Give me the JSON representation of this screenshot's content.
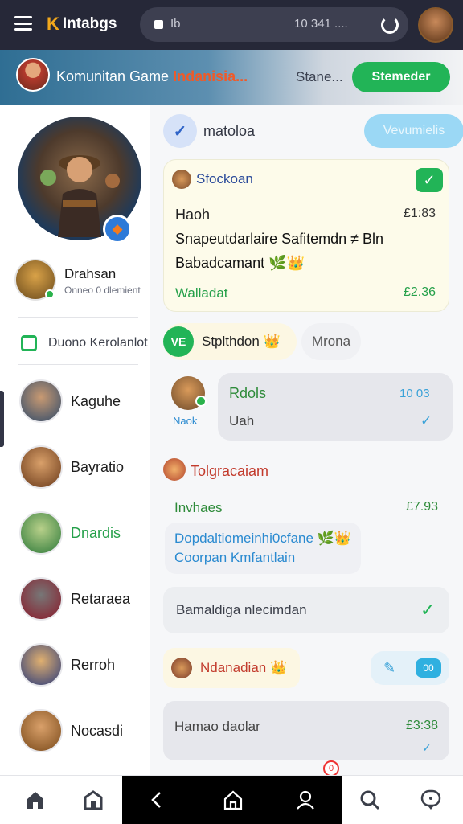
{
  "browser": {
    "app_name": "Intabgs",
    "url_text": "Ib",
    "url_right": "10 341 ....",
    "icons": {
      "menu": "hamburger-icon",
      "logo": "k-logo-icon",
      "reload": "reload-icon"
    }
  },
  "banner": {
    "title": "Komunitan Game ",
    "title_highlight": "Indanisia...",
    "status": "Stane...",
    "button": "Stemeder"
  },
  "sidebar": {
    "profile": {
      "name": "Drahsan",
      "subtitle": "Onneo 0 dlemient"
    },
    "section": "Duono Kerolanlot",
    "users": [
      {
        "name": "Kaguhe",
        "color": "#1e1e1e"
      },
      {
        "name": "Bayratio",
        "color": "#1e1e1e"
      },
      {
        "name": "Dnardis",
        "color": "#25a04a"
      },
      {
        "name": "Retaraea",
        "color": "#1e1e1e"
      },
      {
        "name": "Rerroh",
        "color": "#1e1e1e"
      },
      {
        "name": "Nocasdi",
        "color": "#1e1e1e"
      }
    ]
  },
  "channel": {
    "name": "matoloa",
    "button": "Vevumielis"
  },
  "card": {
    "title": "Sfockoan",
    "label": "Haoh",
    "price1": "£1:83",
    "line1": "Snapeutdarlaire Safitemdn ≠ Bln",
    "line2": "Babadcamant 🌿👑",
    "foot": "Walladat",
    "price2": "£2.36"
  },
  "chips": {
    "badge": "VE",
    "primary": "Stplthdon 👑",
    "secondary": "Mrona"
  },
  "message1": {
    "nick": "Naok",
    "title": "Rdols",
    "time": "10 03",
    "body": "Uah"
  },
  "group": {
    "title": "Tolgracaiam",
    "label": "Invhaes",
    "price": "£7.93",
    "line1": "Dopdaltiomeinhi0cfane 🌿👑",
    "line2": "Coorpan Kmfantlain"
  },
  "note": {
    "text": "Bamaldiga nlecimdan"
  },
  "row5": {
    "name": "Ndanadian 👑",
    "chat_label": "00"
  },
  "message6": {
    "text": "Hamao daolar",
    "time": "£3:38"
  },
  "notification_count": "0",
  "colors": {
    "accent_green": "#22b457",
    "topbar": "#262838",
    "accent_blue": "#2fb0e0",
    "danger": "#c23a2c"
  }
}
